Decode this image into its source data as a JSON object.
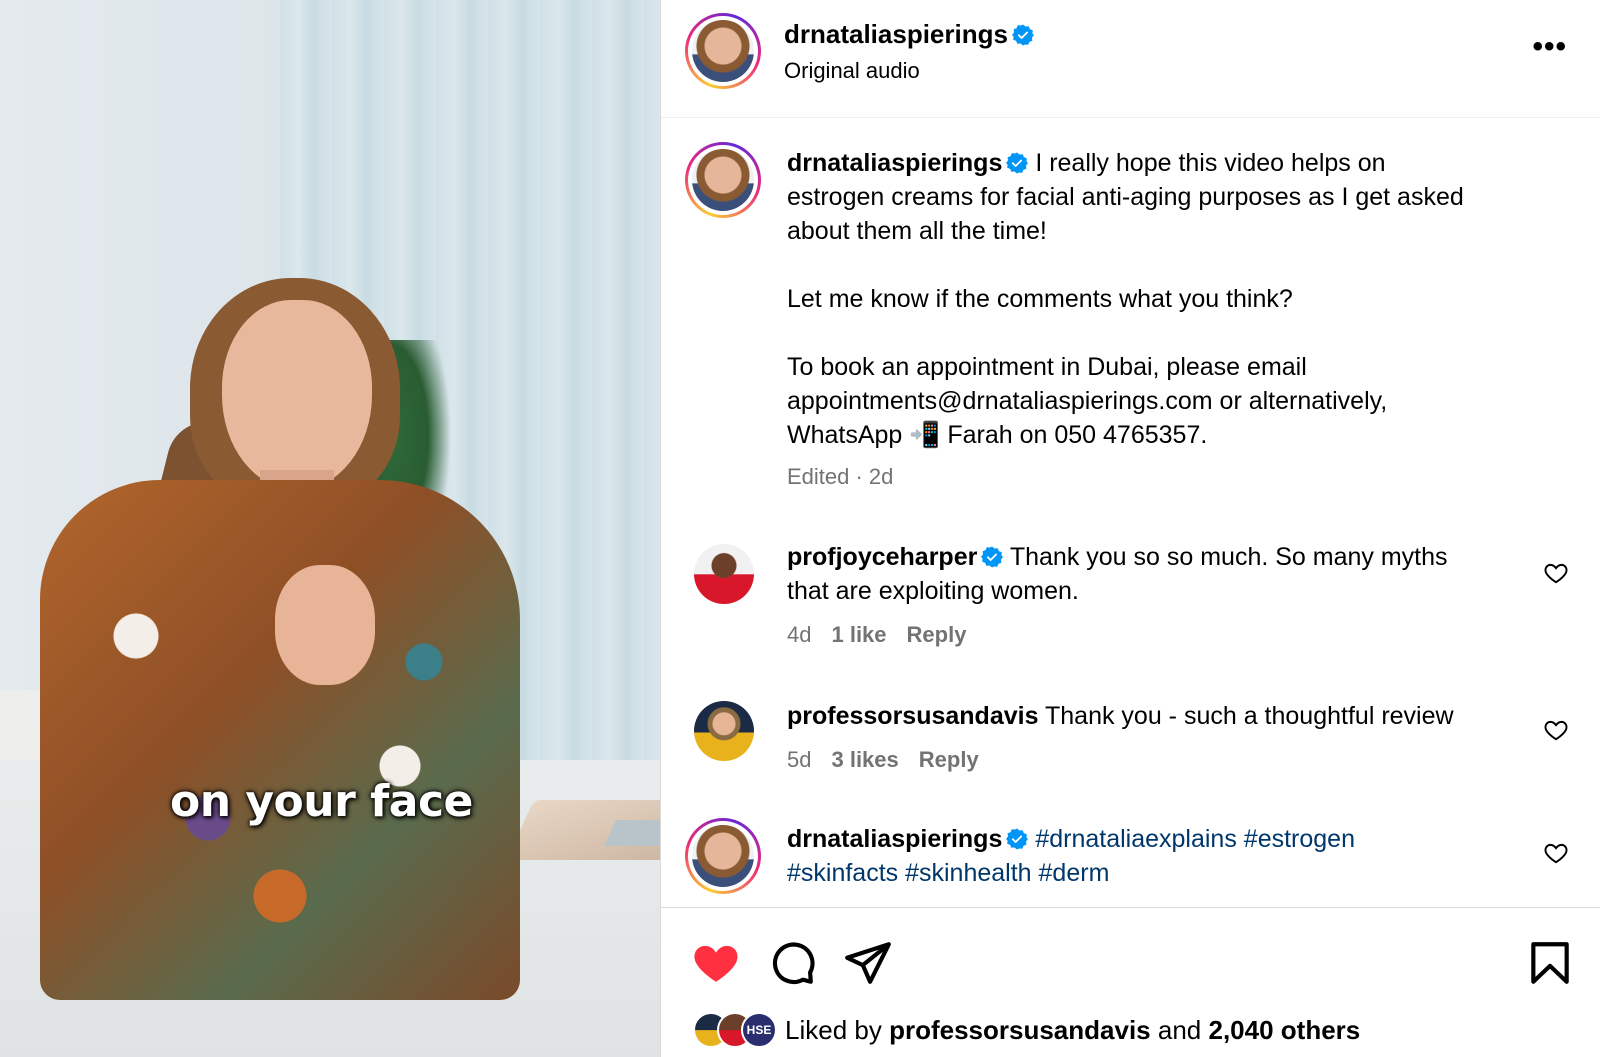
{
  "video": {
    "caption": "on your face"
  },
  "header": {
    "username": "drnataliaspierings",
    "subtitle": "Original audio",
    "more_label": "•••"
  },
  "caption_post": {
    "username": "drnataliaspierings",
    "line1_rest": "I really hope this video helps on",
    "line2": "estrogen creams for facial anti-aging purposes as I get asked",
    "line3": "about them all the time!",
    "line4": "Let me know if the comments what you think?",
    "line5": "To book an appointment in Dubai, please email",
    "line6": "appointments@drnataliaspierings.com or alternatively,",
    "line7": "WhatsApp 📲 Farah on 050 4765357.",
    "meta": "Edited · 2d"
  },
  "comments": [
    {
      "username": "profjoyceharper",
      "line1": "Thank you so so much. So many myths",
      "line2": "that are exploiting women.",
      "age": "4d",
      "likes": "1 like",
      "reply": "Reply"
    },
    {
      "username": "professorsusandavis",
      "line1": "Thank you - such a thoughtful review",
      "age": "5d",
      "likes": "3 likes",
      "reply": "Reply"
    },
    {
      "username": "drnataliaspierings",
      "line1": "#drnataliaexplains #estrogen",
      "line2": "#skinfacts #skinhealth #derm"
    }
  ],
  "likes": {
    "prefix": "Liked by",
    "user": "professorsusandavis",
    "middle": "and",
    "others": "2,040 others",
    "mini_avatar_label": "HSE"
  },
  "colors": {
    "like_red": "#ff3040",
    "verified_blue": "#0095f6",
    "hashtag_blue": "#00376b",
    "meta_gray": "#737373"
  },
  "icons": [
    "verified-badge-icon",
    "more-options-icon",
    "heart-icon",
    "comment-icon",
    "share-icon",
    "bookmark-icon"
  ]
}
